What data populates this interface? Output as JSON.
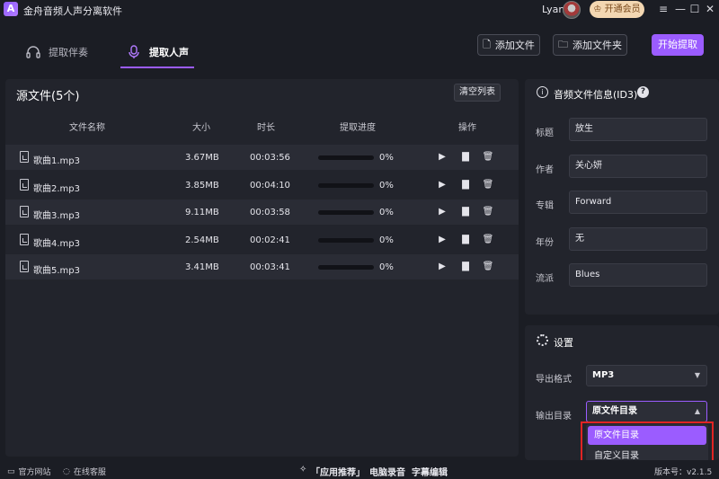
{
  "app": {
    "logo_letter": "A",
    "title": "金舟音频人声分离软件",
    "user_name": "Lyan",
    "vip_label": "开通会员",
    "window_controls": [
      "≡",
      "—",
      "☐",
      "✕"
    ]
  },
  "toolbar": {
    "tabs": [
      {
        "label": "提取伴奏",
        "icon": "headphones-icon",
        "active": false
      },
      {
        "label": "提取人声",
        "icon": "microphone-icon",
        "active": true
      }
    ],
    "add_file_label": "添加文件",
    "add_folder_label": "添加文件夹",
    "start_label": "开始提取"
  },
  "file_list": {
    "title": "源文件(5个)",
    "clear_label": "清空列表",
    "columns": [
      "文件名称",
      "大小",
      "时长",
      "提取进度",
      "操作"
    ],
    "rows": [
      {
        "name": "歌曲1.mp3",
        "size": "3.67MB",
        "duration": "00:03:56",
        "progress": "0%",
        "progress_value": 0
      },
      {
        "name": "歌曲2.mp3",
        "size": "3.85MB",
        "duration": "00:04:10",
        "progress": "0%",
        "progress_value": 0
      },
      {
        "name": "歌曲3.mp3",
        "size": "9.11MB",
        "duration": "00:03:58",
        "progress": "0%",
        "progress_value": 0
      },
      {
        "name": "歌曲4.mp3",
        "size": "2.54MB",
        "duration": "00:02:41",
        "progress": "0%",
        "progress_value": 0
      },
      {
        "name": "歌曲5.mp3",
        "size": "3.41MB",
        "duration": "00:03:41",
        "progress": "0%",
        "progress_value": 0
      }
    ]
  },
  "id3": {
    "title": "音频文件信息(ID3)",
    "fields": [
      {
        "label": "标题",
        "value": "放生"
      },
      {
        "label": "作者",
        "value": "关心妍"
      },
      {
        "label": "专辑",
        "value": "Forward"
      },
      {
        "label": "年份",
        "value": "无"
      },
      {
        "label": "流派",
        "value": "Blues"
      }
    ]
  },
  "settings": {
    "title": "设置",
    "format_label": "导出格式",
    "format_value": "MP3",
    "output_label": "输出目录",
    "output_value": "原文件目录",
    "output_options": [
      "原文件目录",
      "自定义目录"
    ]
  },
  "status": {
    "website_label": "官方网站",
    "support_label": "在线客服",
    "recommend_label": "「应用推荐」",
    "recorder_label": "电脑录音",
    "subtitle_label": "字幕编辑",
    "version_label": "版本号：v2.1.5"
  },
  "colors": {
    "accent": "#9b5cff",
    "background": "#1b1d24",
    "panel": "#22242c",
    "highlight_outline": "#e02424"
  }
}
